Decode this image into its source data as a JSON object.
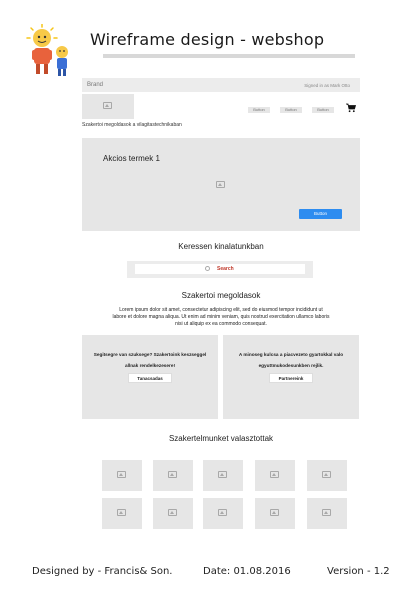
{
  "sheet": {
    "title": "Wireframe design - webshop"
  },
  "navbar": {
    "brand": "Brand",
    "signed_in": "Signed in as Mark Otto"
  },
  "header": {
    "tagline": "Szakertoi megoldasok a vilagitastechnikaban",
    "buttons": [
      "Button",
      "Button",
      "Button"
    ]
  },
  "hero": {
    "title": "Akcios termek 1",
    "button": "Button"
  },
  "search_section": {
    "heading": "Keressen kinalatunkban",
    "search_label": "Search"
  },
  "solutions": {
    "heading": "Szakertoi megoldasok",
    "paragraph": "Lorem ipsum dolor sit amet, consectetur adipiscing elit, sed do eiusmod tempor incididunt ut labore et dolore magna aliqua. Ut enim ad minim veniam, quis nostrud exercitation ullamco laboris nisi ut aliquip ex ea commodo consequat."
  },
  "panels": [
    {
      "text": "Segitsegre van szuksege? Szakertoink keszseggel allnak rendelkezesere!",
      "button": "Tanacsadas"
    },
    {
      "text": "A minoseg kulcsa a piacvezeto gyartokkal valo egyuttmukodesunkben rejlik.",
      "button": "Partnereink"
    }
  ],
  "gallery": {
    "heading": "Szakertelmunket valasztottak"
  },
  "footer": {
    "designed_by": "Designed by - Francis& Son.",
    "date": "Date: 01.08.2016",
    "version": "Version - 1.2"
  },
  "colors": {
    "primary_button": "#2d8cf0",
    "search_text": "#c0392b",
    "placeholder_gray": "#e6e6e6"
  }
}
